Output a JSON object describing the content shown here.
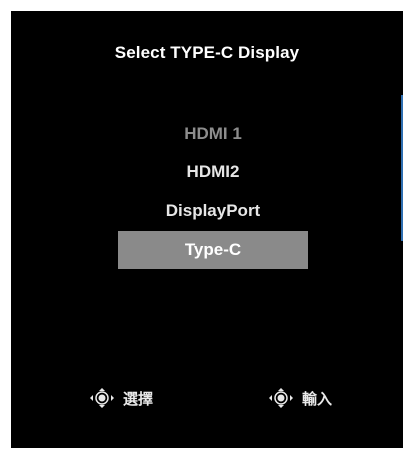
{
  "title": "Select TYPE-C Display",
  "menu": {
    "items": [
      {
        "label": "HDMI 1",
        "state": "disabled"
      },
      {
        "label": "HDMI2",
        "state": "enabled"
      },
      {
        "label": "DisplayPort",
        "state": "enabled"
      },
      {
        "label": "Type-C",
        "state": "selected"
      }
    ]
  },
  "hints": {
    "select": {
      "icon": "joystick-icon",
      "label": "選擇"
    },
    "enter": {
      "icon": "joystick-icon",
      "label": "輸入"
    }
  },
  "colors": {
    "background": "#000000",
    "selected_bg": "#8a8a8a",
    "disabled_text": "#8d8d8d",
    "accent": "#2f6fb1"
  }
}
